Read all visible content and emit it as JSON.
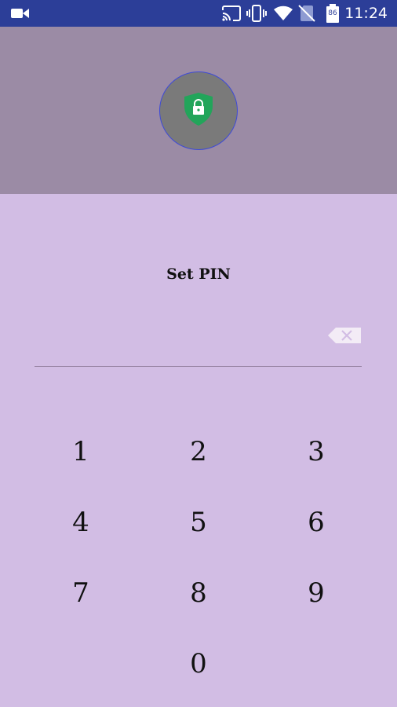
{
  "status_bar": {
    "time": "11:24",
    "battery_level": "86",
    "icons": [
      "video-camera-icon",
      "cast-icon",
      "vibrate-icon",
      "wifi-icon",
      "no-sim-icon",
      "battery-icon"
    ]
  },
  "header": {
    "icon": "shield-lock-icon",
    "colors": {
      "background": "#9b8ba5",
      "shield": "#22a55a",
      "circle": "#7a7a7a",
      "circle_border": "#3d4ad8"
    }
  },
  "pin": {
    "title": "Set PIN",
    "value": "",
    "backspace_icon": "backspace-icon"
  },
  "keypad": {
    "keys": [
      "1",
      "2",
      "3",
      "4",
      "5",
      "6",
      "7",
      "8",
      "9",
      "0"
    ]
  },
  "colors": {
    "background": "#d2bde4",
    "status_bar": "#2c3e98"
  }
}
